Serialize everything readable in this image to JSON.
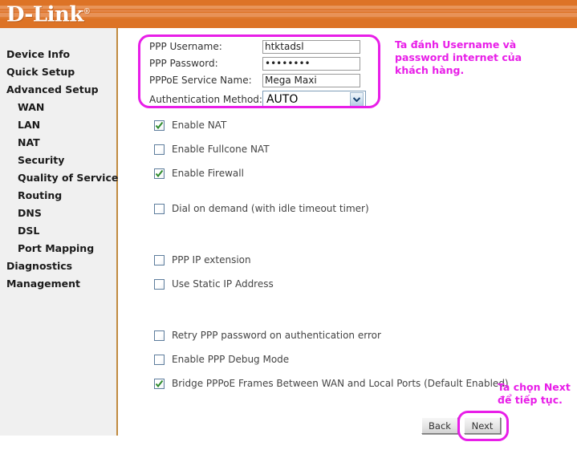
{
  "header": {
    "brand": "D-Link",
    "registered_mark": "®"
  },
  "sidebar": {
    "items": [
      {
        "label": "Device Info",
        "level": "top"
      },
      {
        "label": "Quick Setup",
        "level": "top"
      },
      {
        "label": "Advanced Setup",
        "level": "top"
      },
      {
        "label": "WAN",
        "level": "sub"
      },
      {
        "label": "LAN",
        "level": "sub"
      },
      {
        "label": "NAT",
        "level": "sub"
      },
      {
        "label": "Security",
        "level": "sub"
      },
      {
        "label": "Quality of Service",
        "level": "sub"
      },
      {
        "label": "Routing",
        "level": "sub"
      },
      {
        "label": "DNS",
        "level": "sub"
      },
      {
        "label": "DSL",
        "level": "sub"
      },
      {
        "label": "Port Mapping",
        "level": "sub"
      },
      {
        "label": "Diagnostics",
        "level": "top"
      },
      {
        "label": "Management",
        "level": "top"
      }
    ]
  },
  "form": {
    "username_label": "PPP Username:",
    "username_value": "htktadsl",
    "password_label": "PPP Password:",
    "password_value": "••••••••",
    "service_name_label": "PPPoE Service Name:",
    "service_name_value": "Mega Maxi",
    "auth_label": "Authentication Method:",
    "auth_value": "AUTO"
  },
  "checkboxes": [
    {
      "label": "Enable NAT",
      "checked": true
    },
    {
      "label": "Enable Fullcone NAT",
      "checked": false
    },
    {
      "label": "Enable Firewall",
      "checked": true
    },
    {
      "label": "Dial on demand (with idle timeout timer)",
      "checked": false
    },
    {
      "label": "PPP IP extension",
      "checked": false
    },
    {
      "label": "Use Static IP Address",
      "checked": false
    },
    {
      "label": "Retry PPP password on authentication error",
      "checked": false
    },
    {
      "label": "Enable PPP Debug Mode",
      "checked": false
    },
    {
      "label": "Bridge PPPoE Frames Between WAN and Local Ports (Default Enabled)",
      "checked": true
    }
  ],
  "annotations": {
    "top": "Ta đánh Username và password internet của khách hàng.",
    "next": "Ta chọn Next để tiếp tục."
  },
  "buttons": {
    "back": "Back",
    "next": "Next"
  },
  "colors": {
    "header_orange": "#dd7326",
    "annotation_magenta": "#e81ee8",
    "sidebar_bg": "#f0f0f0",
    "divider": "#c08a3e",
    "check_green": "#2e8b2e"
  }
}
